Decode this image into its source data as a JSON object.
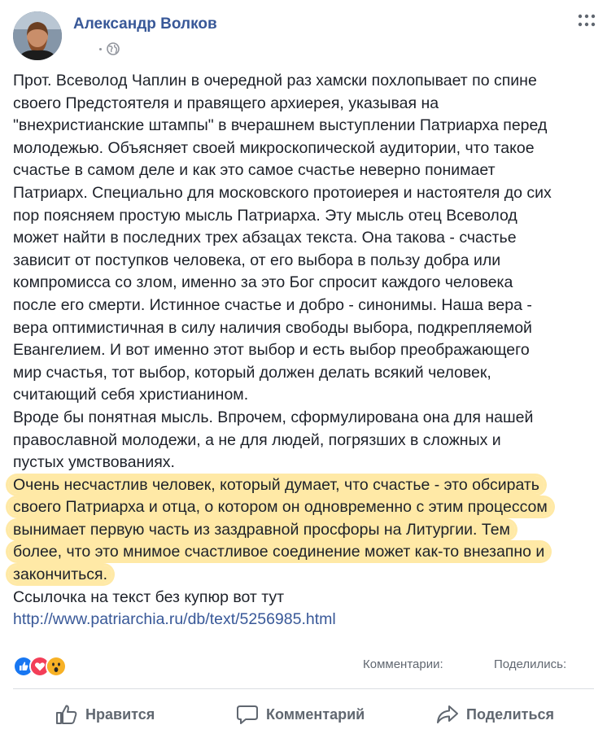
{
  "post": {
    "author": "Александр Волков",
    "privacy_icon": "globe-icon",
    "more_icon": "more-dots-icon",
    "paragraphs": [
      "Прот. Всеволод Чаплин в очередной раз хамски похлопывает по спине",
      "своего Предстоятеля и правящего архиерея, указывая на",
      "\"внехристианские штампы\" в вчерашнем выступлении Патриарха перед",
      "молодежью. Объясняет своей микроскопической аудитории, что такое",
      "счастье в самом деле и как это самое счастье неверно понимает",
      "Патриарх. Специально для московского протоиерея и настоятеля до сих",
      "пор поясняем простую мысль Патриарха. Эту мысль отец Всеволод",
      "может найти в последних трех абзацах текста. Она такова - счастье",
      "зависит от поступков человека, от его выбора в пользу добра или",
      "компромисса со злом, именно за это Бог спросит каждого человека",
      "после его смерти. Истинное счастье и добро - синонимы. Наша вера -",
      "вера оптимистичная в силу наличия свободы выбора, подкрепляемой",
      "Евангелием. И вот именно этот выбор и есть выбор преображающего",
      "мир счастья, тот выбор, который должен делать всякий человек,",
      "считающий себя христианином.",
      "Вроде бы понятная мысль. Впрочем, сформулирована она для нашей",
      "православной молодежи, а не для людей, погрязших в сложных и",
      "пустых умствованиях."
    ],
    "highlighted": [
      "Очень несчастлив человек, который думает, что счастье - это обсирать",
      "своего Патриарха и отца, о котором он одновременно с этим процессом",
      "вынимает первую часть из заздравной просфоры на Литургии. Тем",
      "более, что это мнимое счастливое соединение может как-то внезапно и",
      "закончиться."
    ],
    "link_intro": "Ссылочка на текст без купюр вот тут",
    "link_url": "http://www.patriarchia.ru/db/text/5256985.html"
  },
  "stats": {
    "reactions": [
      "like",
      "love",
      "wow"
    ],
    "comments_label": "Комментарии:",
    "shares_label": "Поделились:"
  },
  "actions": {
    "like": "Нравится",
    "comment": "Комментарий",
    "share": "Поделиться"
  },
  "colors": {
    "author": "#385898",
    "highlight": "#ffe9a6",
    "muted": "#606770",
    "like": "#1877f2",
    "love": "#f33e58",
    "wow": "#f7b125"
  }
}
